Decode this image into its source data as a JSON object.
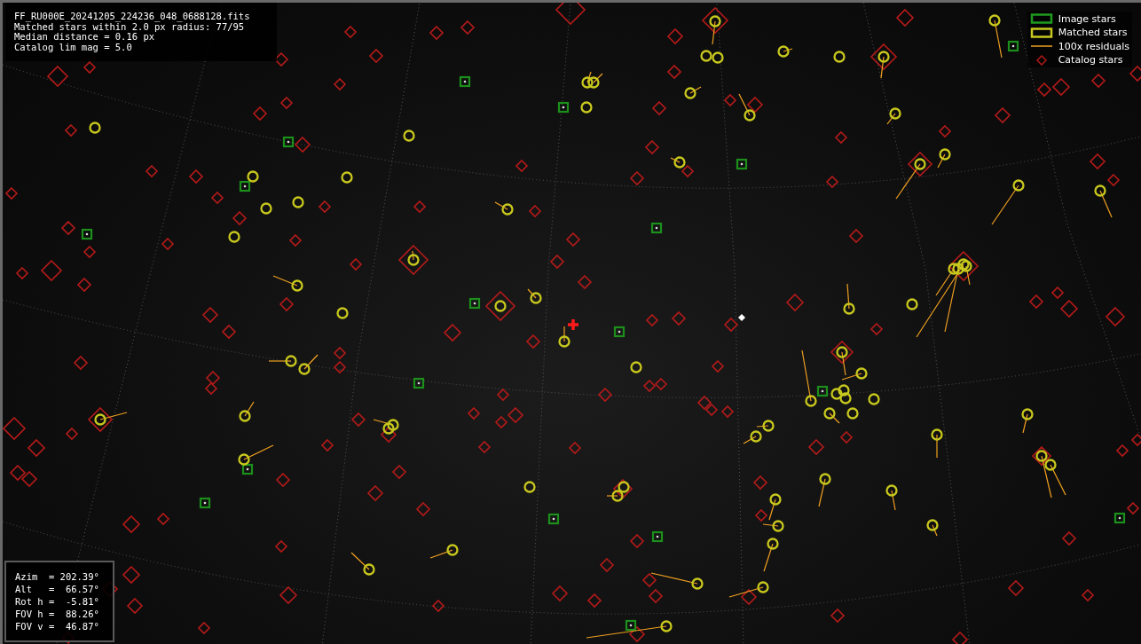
{
  "info": {
    "lines": [
      "FF_RU000E_20241205_224236_048_0688128.fits",
      "Matched stars within 2.0 px radius: 77/95",
      "Median distance = 0.16 px",
      "Catalog lim mag = 5.0"
    ]
  },
  "legend": [
    {
      "kind": "image",
      "label": "Image stars"
    },
    {
      "kind": "matched",
      "label": "Matched stars"
    },
    {
      "kind": "residual",
      "label": "100x residuals"
    },
    {
      "kind": "catalog",
      "label": "Catalog stars"
    }
  ],
  "pointing": {
    "lines": [
      "Azim  = 202.39°",
      "Alt   =  66.57°",
      "Rot h =  -5.81°",
      "FOV h =  88.26°",
      "FOV v =  46.87°"
    ]
  }
}
